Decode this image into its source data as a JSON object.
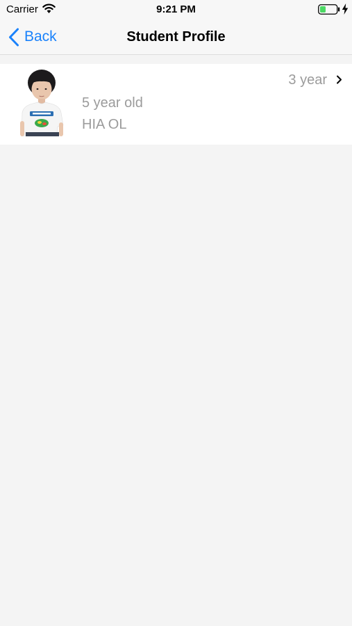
{
  "status_bar": {
    "carrier": "Carrier",
    "time": "9:21 PM",
    "battery_color": "#4cd964"
  },
  "nav": {
    "back_label": "Back",
    "title": "Student Profile",
    "accent_color": "#1a82fb"
  },
  "students": [
    {
      "years": "3 year",
      "age": "5 year old",
      "name": "HIA OL"
    }
  ]
}
